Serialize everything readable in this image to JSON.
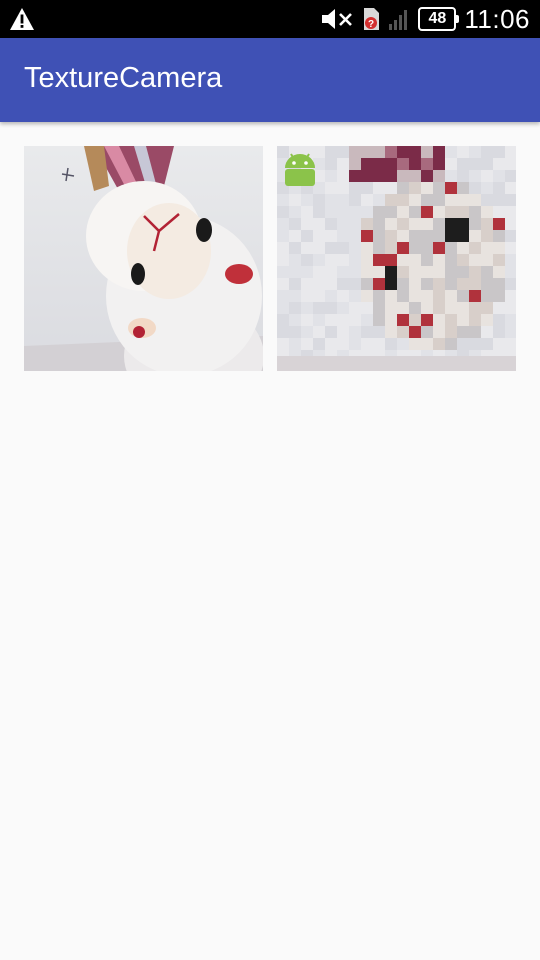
{
  "status_bar": {
    "warning_icon": "warning-icon",
    "mute_icon": "volume-muted-icon",
    "sim_icon": "sim-unknown-icon",
    "signal_icon": "signal-icon",
    "battery_level": "48",
    "time": "11:06"
  },
  "app_bar": {
    "title": "TextureCamera",
    "color": "#3f51b5"
  },
  "main": {
    "camera_preview_icon": "camera-preview",
    "filtered_preview_icon": "pixelated-preview",
    "android_badge_icon": "android-icon"
  }
}
